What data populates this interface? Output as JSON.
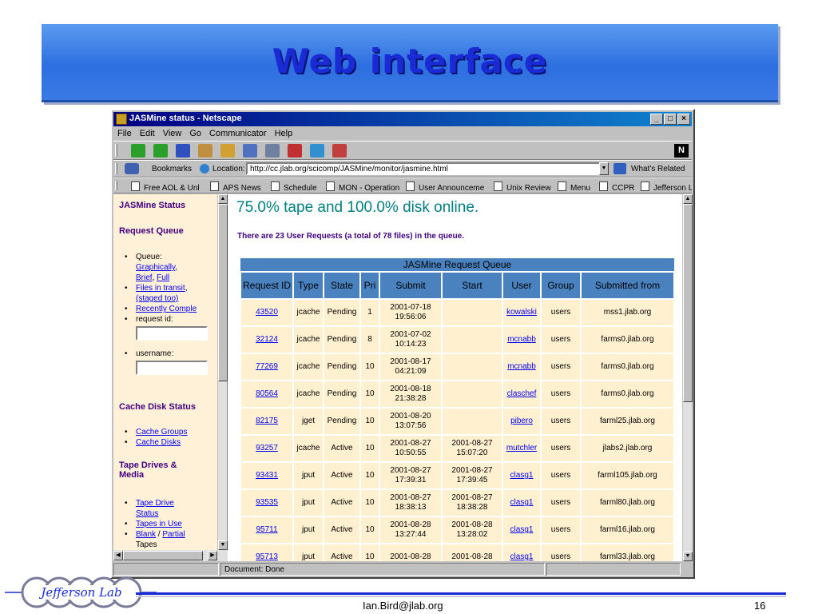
{
  "slide": {
    "title": "Web interface",
    "footer_email": "Ian.Bird@jlab.org",
    "page_number": "16",
    "logo_text": "Jefferson Lab"
  },
  "browser": {
    "window_title": "JASMine status - Netscape",
    "menu": [
      "File",
      "Edit",
      "View",
      "Go",
      "Communicator",
      "Help"
    ],
    "bookmarks_label": "Bookmarks",
    "location_label": "Location:",
    "url": "http://cc.jlab.org/scicomp/JASMine/monitor/jasmine.html",
    "whats_related": "What's Related",
    "personal_toolbar": [
      "Free AOL & Unl",
      "APS News",
      "Schedule",
      "MON - Operation",
      "User Announceme",
      "Unix Review",
      "Menu",
      "CCPR",
      "Jefferson L"
    ],
    "status_text": "Document: Done"
  },
  "sidebar": {
    "heading_status": "JASMine Status",
    "heading_queue": "Request Queue",
    "queue_label": "Queue:",
    "graphically": "Graphically",
    "brief": "Brief",
    "full": "Full",
    "files_in_transit": "Files in transit",
    "staged_too": "(staged too)",
    "recently_completed": "Recently Comple",
    "request_id": "request id:",
    "username": "username:",
    "heading_cache": "Cache Disk Status",
    "cache_groups": "Cache Groups",
    "cache_disks": "Cache Disks",
    "heading_tape_1": "Tape Drives &",
    "heading_tape_2": "Media",
    "tape_drive_1": "Tape Drive",
    "tape_drive_2": "Status",
    "tapes_in_use": "Tapes in Use",
    "blank": "Blank",
    "partial": "Partial",
    "tapes": "Tapes"
  },
  "main": {
    "headline": "75.0% tape and 100.0% disk online.",
    "queue_note": "There are 23 User Requests (a total of 78 files) in the queue.",
    "table_caption": "JASMine Request Queue",
    "columns": [
      "Request ID",
      "Type",
      "State",
      "Pri",
      "Submit",
      "Start",
      "User",
      "Group",
      "Submitted from"
    ],
    "rows": [
      {
        "id": "43520",
        "type": "jcache",
        "state": "Pending",
        "pri": "1",
        "submit_date": "2001-07-18",
        "submit_time": "19:56:06",
        "start_date": "",
        "start_time": "",
        "user": "kowalski",
        "group": "users",
        "from": "mss1.jlab.org"
      },
      {
        "id": "32124",
        "type": "jcache",
        "state": "Pending",
        "pri": "8",
        "submit_date": "2001-07-02",
        "submit_time": "10:14:23",
        "start_date": "",
        "start_time": "",
        "user": "mcnabb",
        "group": "users",
        "from": "farms0.jlab.org"
      },
      {
        "id": "77269",
        "type": "jcache",
        "state": "Pending",
        "pri": "10",
        "submit_date": "2001-08-17",
        "submit_time": "04:21:09",
        "start_date": "",
        "start_time": "",
        "user": "mcnabb",
        "group": "users",
        "from": "farms0.jlab.org"
      },
      {
        "id": "80564",
        "type": "jcache",
        "state": "Pending",
        "pri": "10",
        "submit_date": "2001-08-18",
        "submit_time": "21:38:28",
        "start_date": "",
        "start_time": "",
        "user": "claschef",
        "group": "users",
        "from": "farms0.jlab.org"
      },
      {
        "id": "82175",
        "type": "jget",
        "state": "Pending",
        "pri": "10",
        "submit_date": "2001-08-20",
        "submit_time": "13:07:56",
        "start_date": "",
        "start_time": "",
        "user": "pibero",
        "group": "users",
        "from": "farml25.jlab.org"
      },
      {
        "id": "93257",
        "type": "jcache",
        "state": "Active",
        "pri": "10",
        "submit_date": "2001-08-27",
        "submit_time": "10:50:55",
        "start_date": "2001-08-27",
        "start_time": "15:07:20",
        "user": "mutchler",
        "group": "users",
        "from": "jlabs2.jlab.org"
      },
      {
        "id": "93431",
        "type": "jput",
        "state": "Active",
        "pri": "10",
        "submit_date": "2001-08-27",
        "submit_time": "17:39:31",
        "start_date": "2001-08-27",
        "start_time": "17:39:45",
        "user": "clasg1",
        "group": "users",
        "from": "farml105.jlab.org"
      },
      {
        "id": "93535",
        "type": "jput",
        "state": "Active",
        "pri": "10",
        "submit_date": "2001-08-27",
        "submit_time": "18:38:13",
        "start_date": "2001-08-27",
        "start_time": "18:38:28",
        "user": "clasg1",
        "group": "users",
        "from": "farml80.jlab.org"
      },
      {
        "id": "95711",
        "type": "jput",
        "state": "Active",
        "pri": "10",
        "submit_date": "2001-08-28",
        "submit_time": "13:27:44",
        "start_date": "2001-08-28",
        "start_time": "13:28:02",
        "user": "clasg1",
        "group": "users",
        "from": "farml16.jlab.org"
      },
      {
        "id": "95713",
        "type": "jput",
        "state": "Active",
        "pri": "10",
        "submit_date": "2001-08-28",
        "submit_time": "",
        "start_date": "2001-08-28",
        "start_time": "",
        "user": "clasg1",
        "group": "users",
        "from": "farml33.jlab.org"
      }
    ]
  },
  "colors": {
    "title_text": "#1a2bd6",
    "headline": "#008080",
    "table_header": "#4a82c0",
    "table_cell": "#fff0d0",
    "sidebar_bg": "#fff0d8",
    "link": "#0000ee"
  },
  "icons": [
    "back-icon",
    "forward-icon",
    "reload-icon",
    "home-icon",
    "search-icon",
    "netscape-icon",
    "print-icon",
    "security-icon",
    "shop-icon",
    "stop-icon",
    "netscape-logo-icon"
  ]
}
